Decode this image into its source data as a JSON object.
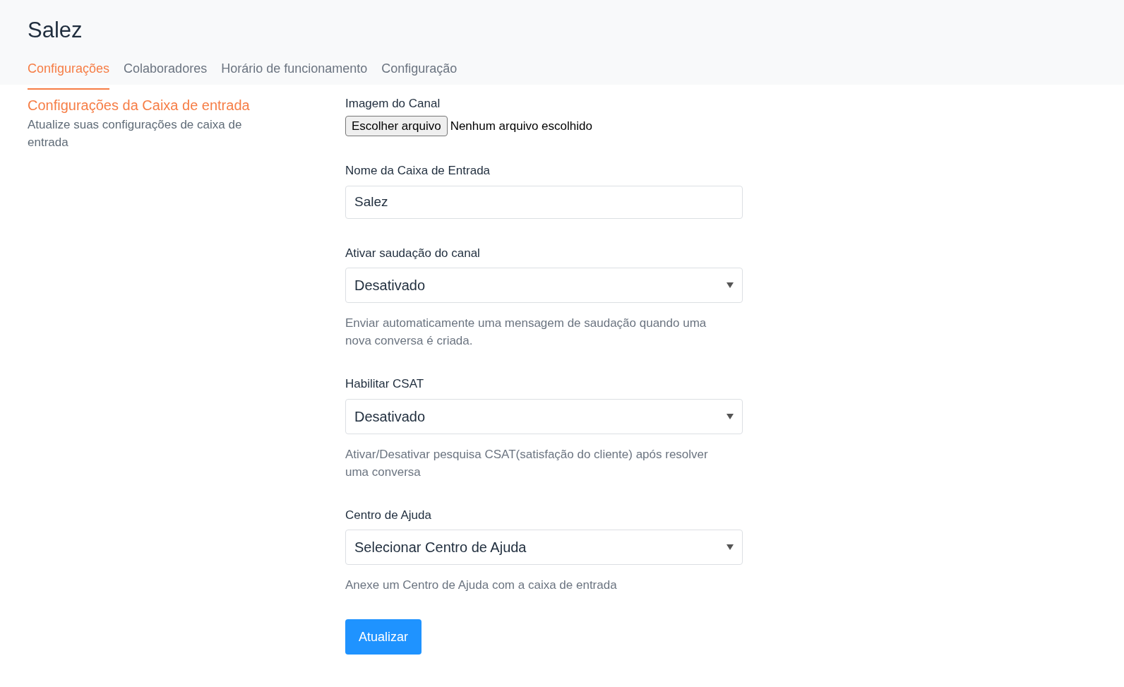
{
  "header": {
    "title": "Salez"
  },
  "tabs": [
    {
      "label": "Configurações",
      "selected": true
    },
    {
      "label": "Colaboradores",
      "selected": false
    },
    {
      "label": "Horário de funcionamento",
      "selected": false
    },
    {
      "label": "Configuração",
      "selected": false
    }
  ],
  "section": {
    "title": "Configurações da Caixa de entrada",
    "description": "Atualize suas configurações de caixa de entrada"
  },
  "form": {
    "fields": [
      {
        "kind": "file",
        "label": "Imagem do Canal",
        "button": "Escolher arquivo",
        "status": "Nenhum arquivo escolhido"
      },
      {
        "kind": "text",
        "label": "Nome da Caixa de Entrada",
        "value": "Salez"
      },
      {
        "kind": "select",
        "label": "Ativar saudação do canal",
        "value": "Desativado",
        "help": "Enviar automaticamente uma mensagem de saudação quando uma nova conversa é criada."
      },
      {
        "kind": "select",
        "label": "Habilitar CSAT",
        "value": "Desativado",
        "help": "Ativar/Desativar pesquisa CSAT(satisfação do cliente) após resolver uma conversa"
      },
      {
        "kind": "select",
        "label": "Centro de Ajuda",
        "value": "Selecionar Centro de Ajuda",
        "help": "Anexe um Centro de Ajuda com a caixa de entrada"
      }
    ],
    "submit": "Atualizar"
  }
}
